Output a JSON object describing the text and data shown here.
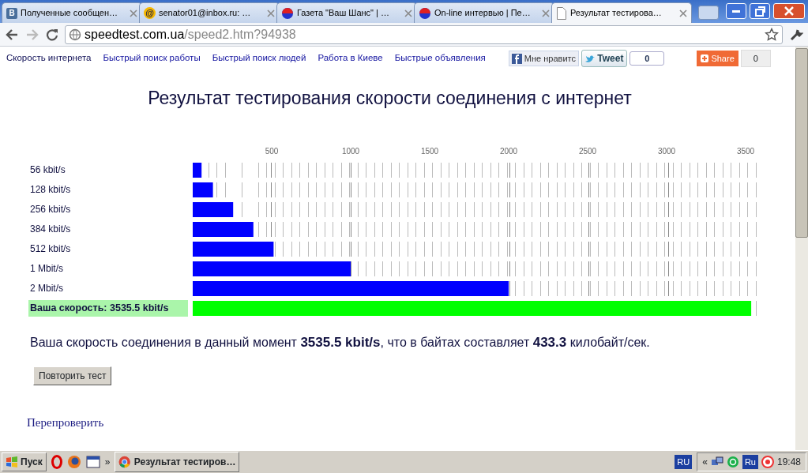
{
  "browser": {
    "tabs": [
      {
        "title": "Полученные сообщен…",
        "kind": "badge",
        "icon_text": "В",
        "selected": false
      },
      {
        "title": "senator01@inbox.ru: …",
        "kind": "at",
        "icon_text": "@",
        "selected": false
      },
      {
        "title": "Газета \"Ваш Шанс\" | …",
        "kind": "dot",
        "selected": false
      },
      {
        "title": "On-line интервью | Пе…",
        "kind": "dot",
        "selected": false
      },
      {
        "title": "Результат тестирова…",
        "kind": "page",
        "selected": true
      }
    ],
    "address": {
      "host": "speedtest.com.ua",
      "path": "/speed2.htm?94938"
    }
  },
  "nav_links": [
    "Скорость интернета",
    "Быстрый поиск работы",
    "Быстрый поиск людей",
    "Работа в Киеве",
    "Быстрые объявления"
  ],
  "social": {
    "like": "Мне нравитс",
    "tweet": "Tweet",
    "tweet_count": "0",
    "share": "Share",
    "share_count": "0"
  },
  "heading": "Результат тестирования скорости соединения с интернет",
  "chart_data": {
    "type": "bar",
    "orientation": "horizontal",
    "xlim": [
      0,
      3600
    ],
    "categories": [
      "56 kbit/s",
      "128 kbit/s",
      "256 kbit/s",
      "384 kbit/s",
      "512 kbit/s",
      "1 Mbit/s",
      "2 Mbit/s",
      "Ваша скорость: 3535.5 kbit/s"
    ],
    "series": [
      {
        "color": "#0000ff",
        "values": [
          56,
          128,
          256,
          384,
          512,
          1000,
          2000,
          null
        ]
      },
      {
        "color": "#00ff00",
        "values": [
          null,
          null,
          null,
          null,
          null,
          null,
          null,
          3535.5
        ]
      }
    ],
    "xticks": [
      500,
      1000,
      1500,
      2000,
      2500,
      3000,
      3500
    ]
  },
  "summary": "Ваша скорость соединения в данный момент **3535.5 kbit/s**, что в байтах составляет **433.3** килобайт/сек.",
  "retest_button": "Повторить тест",
  "recheck_link": "Перепроверить",
  "taskbar": {
    "start": "Пуск",
    "more": "»",
    "tasks": [
      {
        "title": "Результат тестиров…",
        "selected": false
      }
    ],
    "language": "RU",
    "tray_expand": "«",
    "tray_language": "Ru",
    "clock": "19:48"
  }
}
